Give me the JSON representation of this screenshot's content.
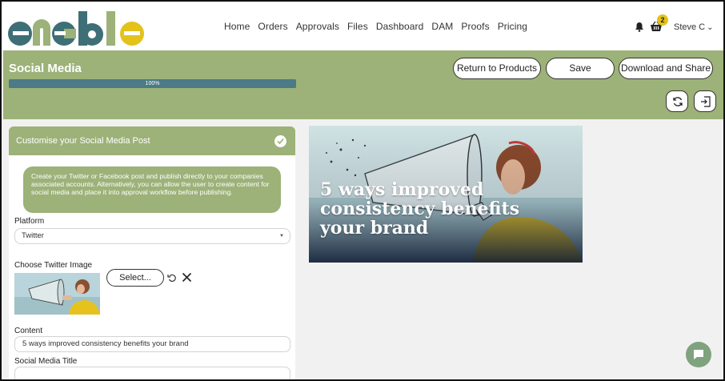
{
  "brand": {
    "logo_text": "enable"
  },
  "nav": {
    "items": [
      {
        "label": "Home"
      },
      {
        "label": "Orders"
      },
      {
        "label": "Approvals"
      },
      {
        "label": "Files"
      },
      {
        "label": "Dashboard"
      },
      {
        "label": "DAM"
      },
      {
        "label": "Proofs"
      },
      {
        "label": "Pricing"
      }
    ]
  },
  "header": {
    "basket_count": "2",
    "user_name": "Steve C",
    "icons": [
      "bell-icon",
      "basket-icon",
      "chevron-down-icon"
    ]
  },
  "titlebar": {
    "title": "Social Media",
    "progress": {
      "value": 100,
      "label": "100%"
    },
    "buttons": {
      "return": "Return to Products",
      "save": "Save",
      "download": "Download and Share"
    },
    "icon_buttons": [
      "refresh-icon",
      "export-icon"
    ]
  },
  "panel": {
    "heading": "Customise your Social Media Post",
    "info": "Create your Twitter or Facebook post and publish directly to your companies associated accounts. Alternatively, you can allow the user to create content for social media and place it into approval workflow before publishing.",
    "platform_label": "Platform",
    "platform_value": "Twitter",
    "image_label": "Choose Twitter Image",
    "select_button": "Select...",
    "content_label": "Content",
    "content_value": "5 ways improved consistency benefits your brand",
    "title_label": "Social Media Title",
    "title_value": ""
  },
  "preview": {
    "headline": "5 ways improved consistency benefits your brand"
  },
  "colors": {
    "brand_green": "#9cb278",
    "progress": "#4c7a86",
    "badge": "#e3c21b",
    "logo_teal": "#3e6f76",
    "logo_yellow": "#e3c21b"
  }
}
